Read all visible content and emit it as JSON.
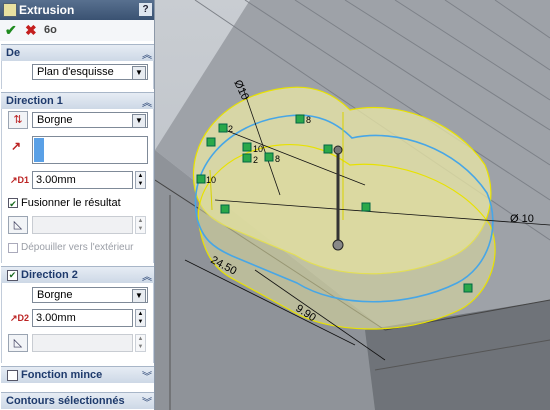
{
  "window": {
    "title": "Extrusion",
    "help": "?"
  },
  "actions": {
    "ok": "✔",
    "cancel": "✖",
    "preview": "6o"
  },
  "de": {
    "title": "De",
    "start_condition": "Plan d'esquisse"
  },
  "direction1": {
    "title": "Direction 1",
    "end_condition": "Borgne",
    "depth": "3.00mm",
    "merge_label": "Fusionner le résultat",
    "outward_label": "Dépouiller vers l'extérieur"
  },
  "direction2": {
    "title": "Direction 2",
    "end_condition": "Borgne",
    "depth": "3.00mm"
  },
  "thin": {
    "title": "Fonction mince"
  },
  "contours": {
    "title": "Contours sélectionnés"
  },
  "viewport": {
    "dimensions": [
      "Ø10",
      "Ø 10",
      "24.50",
      "9.90"
    ],
    "relation_labels": [
      "2",
      "8",
      "10",
      "2",
      "8",
      "10"
    ]
  },
  "icons": {
    "direction-reverse": "direction-reverse-icon",
    "direction-arrow": "direction-arrow-icon",
    "depth": "depth-icon",
    "draft": "draft-icon"
  }
}
